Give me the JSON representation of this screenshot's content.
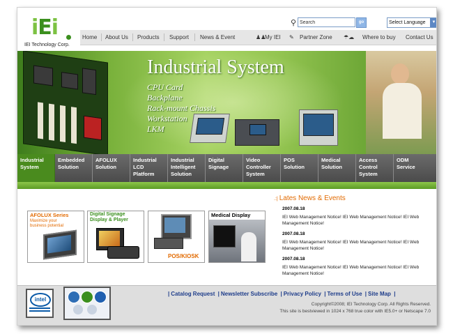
{
  "header": {
    "logo_text": "IEI Technology Corp.",
    "search_placeholder": "Search",
    "search_button": "go",
    "language_select": "Select Language"
  },
  "nav": {
    "home": "Home",
    "about": "About Us",
    "products": "Products",
    "support": "Support",
    "news": "News & Event",
    "my_iei": "My IEI",
    "partner_zone": "Partner Zone",
    "where_to_buy": "Where to buy",
    "contact": "Contact Us"
  },
  "banner": {
    "title": "Industrial System",
    "items": [
      "CPU Card",
      "Backplane",
      "Rack-mount Chassis",
      "Workstation",
      "LKM"
    ]
  },
  "categories": [
    {
      "line1": "Industrial",
      "line2": "System",
      "line3": ""
    },
    {
      "line1": "Embedded",
      "line2": "Solution",
      "line3": ""
    },
    {
      "line1": "AFOLUX",
      "line2": "Solution",
      "line3": ""
    },
    {
      "line1": "Industrial",
      "line2": "LCD",
      "line3": "Platform"
    },
    {
      "line1": "Industrial",
      "line2": "Intelligent",
      "line3": "Solution"
    },
    {
      "line1": "Digital",
      "line2": "Signage",
      "line3": ""
    },
    {
      "line1": "Video",
      "line2": "Controller",
      "line3": "System"
    },
    {
      "line1": "POS",
      "line2": "Solution",
      "line3": ""
    },
    {
      "line1": "Medical",
      "line2": "Solution",
      "line3": ""
    },
    {
      "line1": "Access",
      "line2": "Control",
      "line3": "System"
    },
    {
      "line1": "ODM",
      "line2": "Service",
      "line3": ""
    }
  ],
  "promos": {
    "afolux_title": "AFOLUX Series",
    "afolux_sub1": "Maximize your",
    "afolux_sub2": "business potential",
    "signage_line1": "Digital Signage",
    "signage_line2": "Display & Player",
    "pos_label": "POS/KIOSK",
    "medical_title": "Medical Display"
  },
  "news": {
    "heading": "Lates News & Events",
    "items": [
      {
        "date": "2007.08.18",
        "text": "IEI Web Management Notice! IEI Web Management Notice! IEI Web Management Notice!"
      },
      {
        "date": "2007.08.18",
        "text": "IEI Web Management Notice! IEI Web Management Notice! IEI Web Management Notice!"
      },
      {
        "date": "2007.08.18",
        "text": "IEI Web Management Notice! IEI Web Management Notice! IEI Web Management Notice!"
      }
    ]
  },
  "footer": {
    "catalog": "Catalog Request",
    "newsletter": "Newsletter Subscribe",
    "privacy": "Privacy Policy",
    "terms": "Terms of Use",
    "sitemap": "Site Map",
    "copyright": "Copyright©2008; IEI Technology Corp. All Rights Reserved.",
    "best_viewed": "This site is bestviewed in 1024 x 768 true color with IE5.0+ or Netscape 7.0",
    "intel_badge": "intel"
  }
}
